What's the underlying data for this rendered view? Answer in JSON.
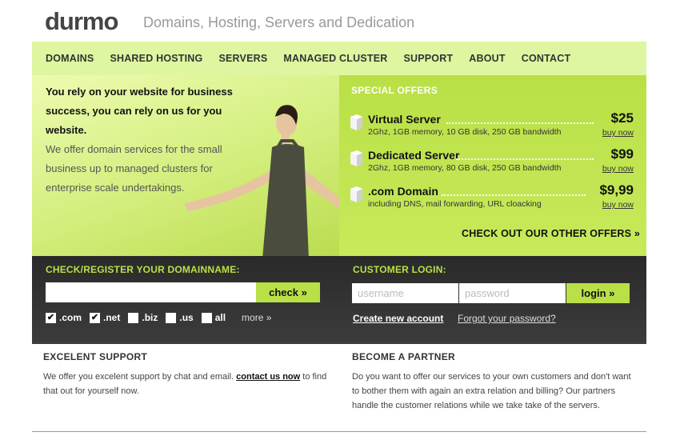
{
  "header": {
    "logo": "durmo",
    "tagline": "Domains, Hosting, Servers and Dedication"
  },
  "nav": [
    "DOMAINS",
    "SHARED HOSTING",
    "SERVERS",
    "MANAGED CLUSTER",
    "SUPPORT",
    "ABOUT",
    "CONTACT"
  ],
  "hero": {
    "strong": "You rely on your website for business success,  you can rely on us for you website.",
    "body": "We offer domain services for the small business up to managed clusters for enterprise scale undertakings."
  },
  "offers": {
    "title": "SPECIAL OFFERS",
    "items": [
      {
        "name": "Virtual Server",
        "desc": "2Ghz, 1GB memory, 10 GB disk, 250 GB bandwidth",
        "price": "$25",
        "buy": "buy now"
      },
      {
        "name": "Dedicated Server",
        "desc": "2Ghz, 1GB memory, 80 GB disk, 250 GB bandwidth",
        "price": "$99",
        "buy": "buy now"
      },
      {
        "name": ".com Domain",
        "desc": "including DNS, mail forwarding, URL cloacking",
        "price": "$9,99",
        "buy": "buy now"
      }
    ],
    "other": "CHECK OUT OUR OTHER OFFERS »"
  },
  "domain": {
    "title": "CHECK/REGISTER YOUR DOMAINNAME:",
    "input_value": "",
    "check_label": "check »",
    "tlds": [
      {
        "label": ".com",
        "checked": true
      },
      {
        "label": ".net",
        "checked": true
      },
      {
        "label": ".biz",
        "checked": false
      },
      {
        "label": ".us",
        "checked": false
      },
      {
        "label": "all",
        "checked": false
      }
    ],
    "more": "more »"
  },
  "login": {
    "title": "CUSTOMER LOGIN:",
    "username_placeholder": "username",
    "password_placeholder": "password",
    "login_label": "login »",
    "create": "Create new account",
    "forgot": "Forgot your password?"
  },
  "support": {
    "title": "EXCELENT SUPPORT",
    "text_before": "We offer you excelent support by chat and email.",
    "link": "contact us now",
    "text_after": "to find that out for yourself now."
  },
  "partner": {
    "title": "BECOME A PARTNER",
    "text": "Do you want to offer our services to your own customers and don't want to bother them with again an extra relation and billing?  Our partners handle the customer relations while we take take of the servers."
  },
  "colors": {
    "accent_green": "#b9e046",
    "nav_bg": "#def6a0",
    "dark_panel": "#333333"
  }
}
